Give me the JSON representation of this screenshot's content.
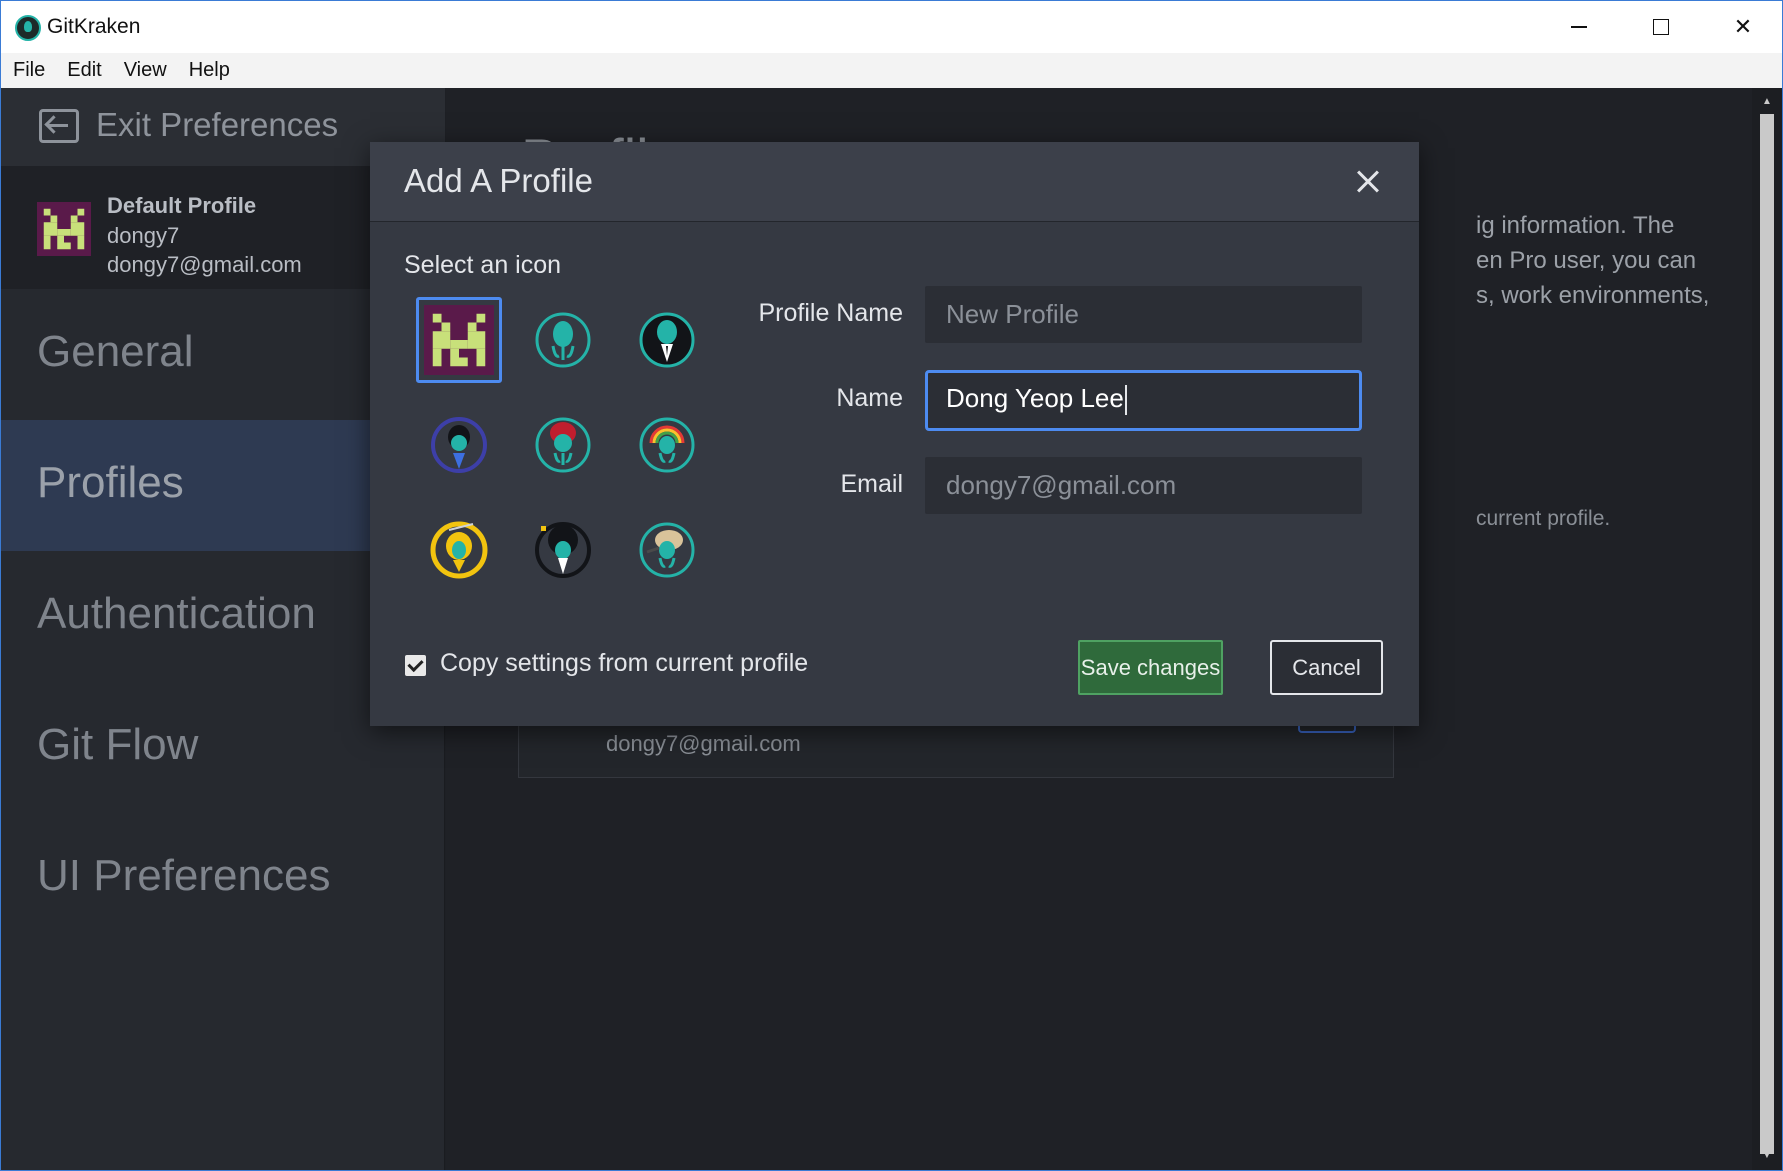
{
  "window": {
    "title": "GitKraken",
    "controls": [
      "minimize",
      "maximize",
      "close"
    ]
  },
  "menubar": {
    "items": [
      "File",
      "Edit",
      "View",
      "Help"
    ]
  },
  "sidebar": {
    "exit_label": "Exit Preferences",
    "profile": {
      "name": "Default Profile",
      "username": "dongy7",
      "email": "dongy7@gmail.com"
    },
    "nav": [
      {
        "label": "General",
        "active": false
      },
      {
        "label": "Profiles",
        "active": true
      },
      {
        "label": "Authentication",
        "active": false
      },
      {
        "label": "Git Flow",
        "active": false
      },
      {
        "label": "UI Preferences",
        "active": false
      }
    ]
  },
  "background": {
    "heading": "Profile",
    "line1": "ig information. The",
    "line2": "en Pro user, you can",
    "line3": "s, work environments,",
    "note": "current profile.",
    "profile_email": "dongy7@gmail.com"
  },
  "modal": {
    "title": "Add A Profile",
    "select_icon_label": "Select an icon",
    "icons": [
      {
        "name": "pixel-kraken-icon",
        "selected": true
      },
      {
        "name": "teal-kraken-icon",
        "selected": false
      },
      {
        "name": "suit-kraken-icon",
        "selected": false
      },
      {
        "name": "blue-cape-kraken-icon",
        "selected": false
      },
      {
        "name": "red-hair-kraken-icon",
        "selected": false
      },
      {
        "name": "rainbow-kraken-icon",
        "selected": false
      },
      {
        "name": "gold-kraken-icon",
        "selected": false
      },
      {
        "name": "afro-kraken-icon",
        "selected": false
      },
      {
        "name": "blonde-kraken-icon",
        "selected": false
      }
    ],
    "fields": {
      "profile_name": {
        "label": "Profile Name",
        "value": "",
        "placeholder": "New Profile"
      },
      "name": {
        "label": "Name",
        "value": "Dong Yeop Lee",
        "placeholder": ""
      },
      "email": {
        "label": "Email",
        "value": "",
        "placeholder": "dongy7@gmail.com"
      }
    },
    "copy_settings": {
      "label": "Copy settings from current profile",
      "checked": true
    },
    "save_label": "Save changes",
    "cancel_label": "Cancel"
  },
  "colors": {
    "accent_blue": "#4d8bf0",
    "save_green": "#2f6a3b",
    "kraken_teal": "#24b3a8",
    "pixel_purple": "#5a1a4a",
    "pixel_green": "#c8e07a"
  }
}
